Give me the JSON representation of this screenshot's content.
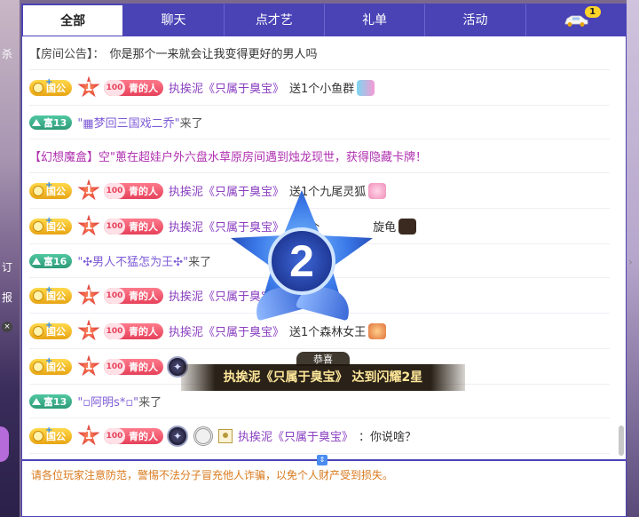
{
  "tabs": [
    {
      "label": "全部",
      "active": true
    },
    {
      "label": "聊天"
    },
    {
      "label": "点才艺"
    },
    {
      "label": "礼单"
    },
    {
      "label": "活动"
    },
    {
      "label": "",
      "icon": "car-icon",
      "badge": "1"
    }
  ],
  "left_strip": {
    "texts": [
      "杀",
      "订",
      "报"
    ],
    "close": "×"
  },
  "announcement": {
    "label": "【房间公告】：",
    "text": "你是那个一来就会让我变得更好的男人吗"
  },
  "badges": {
    "guo": "国公",
    "qing_num": "100",
    "qing": "青的人",
    "fu13": "富13",
    "fu16": "富16",
    "star_num": "1"
  },
  "messages": [
    {
      "type": "gift",
      "nick": "执挨泥《只属于臭宝》",
      "action": "送1个小鱼群"
    },
    {
      "type": "welcome",
      "badge": "富13",
      "name": "\"▦梦回三国戏二乔\"",
      "suffix": "来了"
    },
    {
      "type": "fantasy",
      "text": "【幻想魔盒】空\"蔥在超娃户外六盘水草原房间遇到烛龙现世，获得隐藏卡牌！"
    },
    {
      "type": "gift",
      "nick": "执挨泥《只属于臭宝》",
      "action": "送1个九尾灵狐"
    },
    {
      "type": "gift",
      "nick": "执挨泥《只属于臭宝》",
      "action": "送1个",
      "tail": "旋龟"
    },
    {
      "type": "welcome",
      "badge": "富16",
      "name": "\"✣男人不猛怎为王✣\"",
      "suffix": "来了"
    },
    {
      "type": "gift",
      "nick": "执挨泥《只属于臭宝》",
      "action": ""
    },
    {
      "type": "gift",
      "nick": "执挨泥《只属于臭宝》",
      "action": "送1个森林女王"
    },
    {
      "type": "gift2",
      "nick": "执挨泥《只属于臭宝》",
      "action": ""
    },
    {
      "type": "welcome",
      "badge": "富13",
      "name": "\"▫阿明s*▫\"",
      "suffix": "来了"
    },
    {
      "type": "chat",
      "nick": "执挨泥《只属于臭宝》",
      "action": "：你说啥？"
    }
  ],
  "levelup": {
    "number": "2",
    "small": "恭喜",
    "banner": "执挨泥《只属于臭宝》 达到闪耀2星"
  },
  "tip": "请各位玩家注意防范，警惕不法分子冒充他人诈骗，以免个人财产受到损失。",
  "colors": {
    "tab_bg": "#4a43b6",
    "nick": "#8a3fc0",
    "tip": "#d9791c",
    "fantasy": "#b030b0"
  }
}
